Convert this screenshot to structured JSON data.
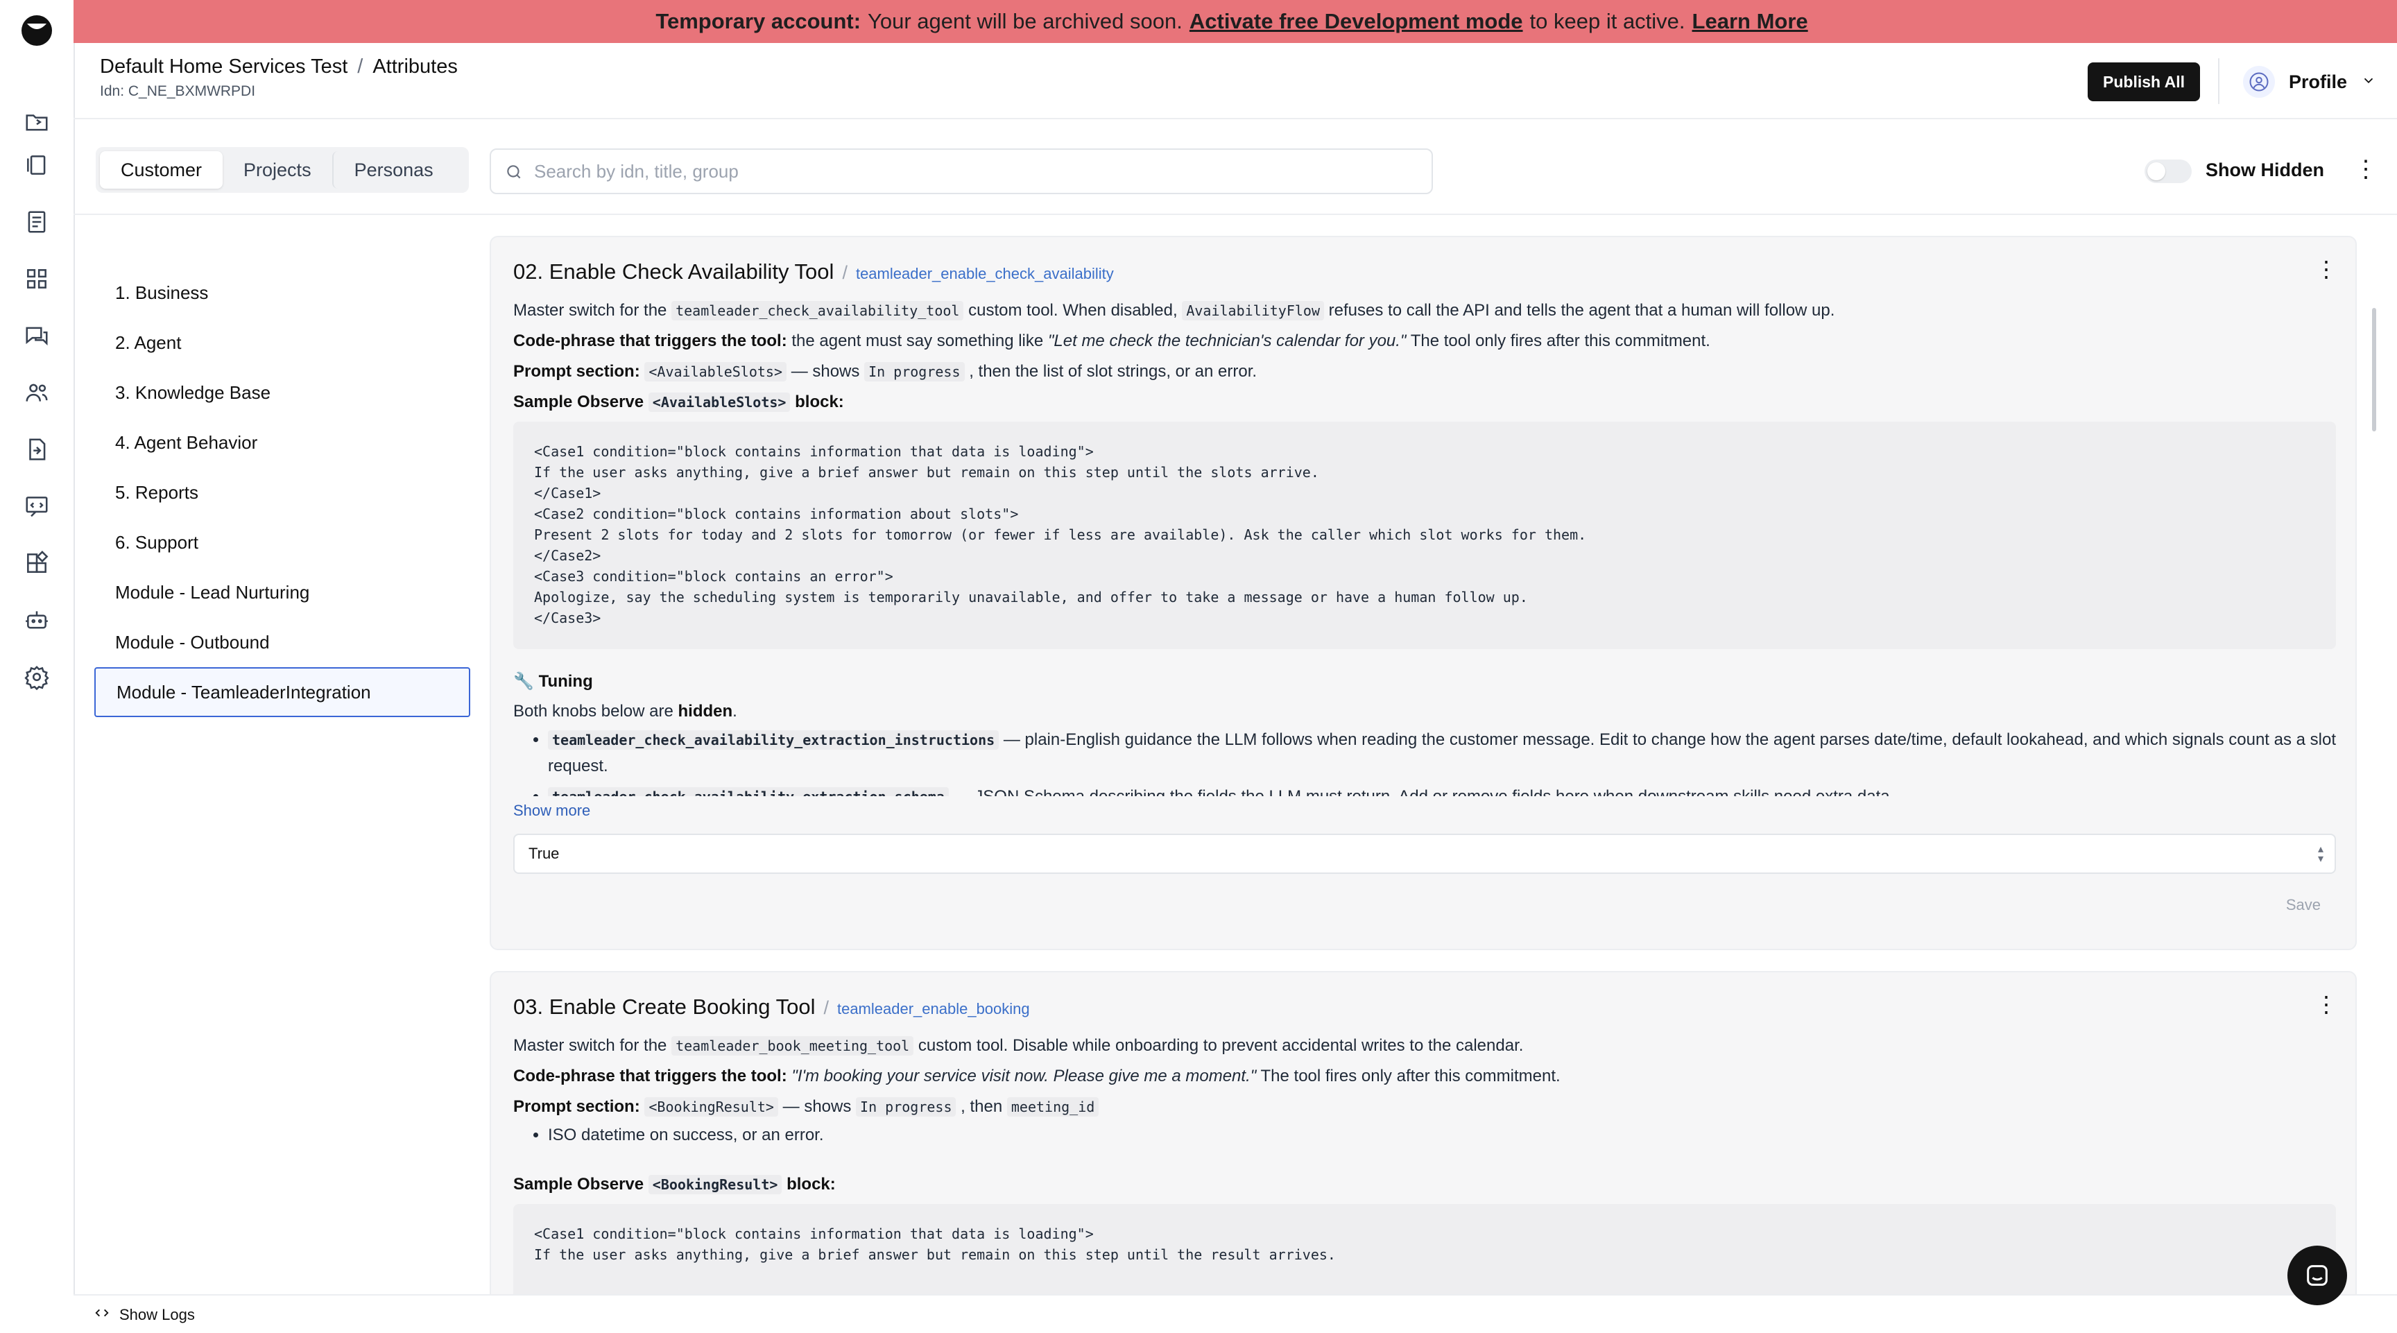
{
  "banner": {
    "bold": "Temporary account:",
    "text": "Your agent will be archived soon.",
    "link": "Activate free Development mode",
    "tail": "to keep it active.",
    "learn": "Learn More"
  },
  "header": {
    "project": "Default Home Services Test",
    "separator": "/",
    "page": "Attributes",
    "idn": "Idn: C_NE_BXMWRPDI",
    "publish_label": "Publish All",
    "profile_label": "Profile"
  },
  "tabs": [
    {
      "label": "Customer",
      "active": true
    },
    {
      "label": "Projects"
    },
    {
      "label": "Personas"
    }
  ],
  "search": {
    "placeholder": "Search by idn, title, group"
  },
  "show_hidden": "Show Hidden",
  "nav": [
    {
      "label": "1. Business"
    },
    {
      "label": "2. Agent"
    },
    {
      "label": "3. Knowledge Base"
    },
    {
      "label": "4. Agent Behavior"
    },
    {
      "label": "5. Reports"
    },
    {
      "label": "6. Support"
    },
    {
      "label": "Module - Lead Nurturing"
    },
    {
      "label": "Module - Outbound"
    },
    {
      "label": "Module - TeamleaderIntegration",
      "selected": true
    }
  ],
  "card1": {
    "title": "02. Enable Check Availability Tool",
    "slash": "/",
    "idn": "teamleader_enable_check_availability",
    "l1_a": "Master switch for the",
    "l1_code1": "teamleader_check_availability_tool",
    "l1_b": "custom tool. When disabled,",
    "l1_code2": "AvailabilityFlow",
    "l1_c": "refuses to call the API and tells the agent that a human will follow up.",
    "l2_bold": "Code-phrase that triggers the tool:",
    "l2_a": "the agent must say something like",
    "l2_italic": "\"Let me check the technician's calendar for you.\"",
    "l2_b": "The tool only fires after this commitment.",
    "l3_bold": "Prompt section:",
    "l3_code1": "<AvailableSlots>",
    "l3_a": "— shows",
    "l3_code2": "In progress",
    "l3_b": ", then the list of slot strings, or an error.",
    "l4_bold": "Sample Observe",
    "l4_code": "<AvailableSlots>",
    "l4_tail": "block:",
    "code": "<Case1 condition=\"block contains information that data is loading\">\nIf the user asks anything, give a brief answer but remain on this step until the slots arrive.\n</Case1>\n<Case2 condition=\"block contains information about slots\">\nPresent 2 slots for today and 2 slots for tomorrow (or fewer if less are available). Ask the caller which slot works for them.\n</Case2>\n<Case3 condition=\"block contains an error\">\nApologize, say the scheduling system is temporarily unavailable, and offer to take a message or have a human follow up.\n</Case3>",
    "tuning": "Tuning",
    "knobs_a": "Both knobs below are",
    "knobs_bold": "hidden",
    "knobs_b": ".",
    "b1_code": "teamleader_check_availability_extraction_instructions",
    "b1_text": "— plain-English guidance the LLM follows when reading the customer message. Edit to change how the agent parses date/time, default lookahead, and which signals count as a slot request.",
    "b2_code": "teamleader_check_availability_extraction_schema",
    "b2_text": "— JSON Schema describing the fields the LLM must return. Add or remove fields here when downstream skills need extra data.",
    "show_more": "Show more",
    "value": "True",
    "save": "Save"
  },
  "card2": {
    "title": "03. Enable Create Booking Tool",
    "slash": "/",
    "idn": "teamleader_enable_booking",
    "l1_a": "Master switch for the",
    "l1_code1": "teamleader_book_meeting_tool",
    "l1_b": "custom tool. Disable while onboarding to prevent accidental writes to the calendar.",
    "l2_bold": "Code-phrase that triggers the tool:",
    "l2_italic": "\"I'm booking your service visit now. Please give me a moment.\"",
    "l2_b": "The tool fires only after this commitment.",
    "l3_bold": "Prompt section:",
    "l3_code1": "<BookingResult>",
    "l3_a": "— shows",
    "l3_code2": "In progress",
    "l3_b": ", then",
    "l3_code3": "meeting_id",
    "bullet": "ISO datetime on success, or an error.",
    "l4_bold": "Sample Observe",
    "l4_code": "<BookingResult>",
    "l4_tail": "block:",
    "code": "<Case1 condition=\"block contains information that data is loading\">\nIf the user asks anything, give a brief answer but remain on this step until the result arrives."
  },
  "bottom": {
    "show_logs": "Show Logs"
  },
  "colors": {
    "banner": "#e8747a",
    "accent": "#3b66d6",
    "link": "#3b6fc9",
    "primary_button": "#141414"
  }
}
